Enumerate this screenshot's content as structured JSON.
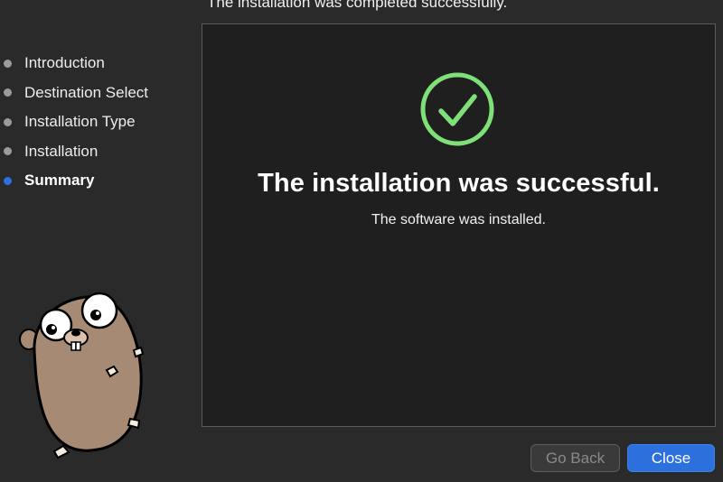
{
  "header": {
    "status_text": "The installation was completed successfully."
  },
  "sidebar": {
    "steps": [
      {
        "label": "Introduction",
        "current": false
      },
      {
        "label": "Destination Select",
        "current": false
      },
      {
        "label": "Installation Type",
        "current": false
      },
      {
        "label": "Installation",
        "current": false
      },
      {
        "label": "Summary",
        "current": true
      }
    ]
  },
  "main": {
    "icon": "checkmark-circle-icon",
    "title": "The installation was successful.",
    "subtitle": "The software was installed."
  },
  "buttons": {
    "back_label": "Go Back",
    "close_label": "Close"
  },
  "colors": {
    "accent": "#2b70dc",
    "success": "#7fe07a",
    "current_step": "#2f6fe0"
  },
  "illustration": "go-gopher-mascot"
}
